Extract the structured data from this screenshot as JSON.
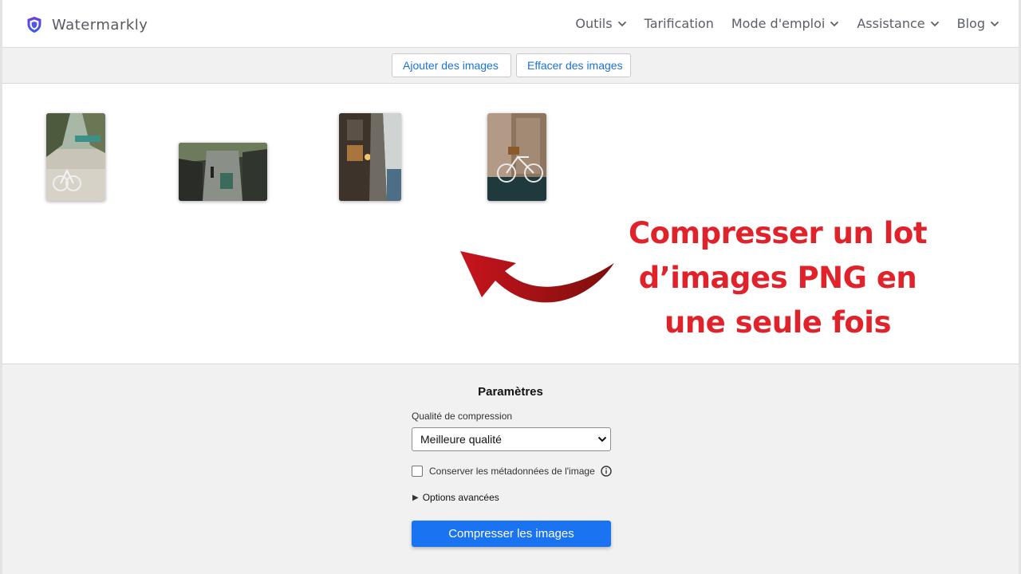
{
  "brand": {
    "name": "Watermarkly",
    "logo_icon": "shield-icon",
    "accent": "#5b4cdb"
  },
  "nav": [
    {
      "label": "Outils",
      "dropdown": true
    },
    {
      "label": "Tarification",
      "dropdown": false
    },
    {
      "label": "Mode d'emploi",
      "dropdown": true
    },
    {
      "label": "Assistance",
      "dropdown": true
    },
    {
      "label": "Blog",
      "dropdown": true
    }
  ],
  "toolbar": {
    "add_label": "Ajouter des images",
    "clear_label": "Effacer des images"
  },
  "headline": {
    "line1": "Compresser un lot",
    "line2": "d’images PNG en",
    "line3": "une seule fois",
    "color": "#e0232b"
  },
  "settings": {
    "title": "Paramètres",
    "quality_label": "Qualité de compression",
    "quality_value": "Meilleure qualité",
    "metadata_label": "Conserver les métadonnées de l'image",
    "metadata_checked": false,
    "advanced_label": "Options avancées",
    "compress_label": "Compresser les images",
    "primary_color": "#1a73f0"
  }
}
